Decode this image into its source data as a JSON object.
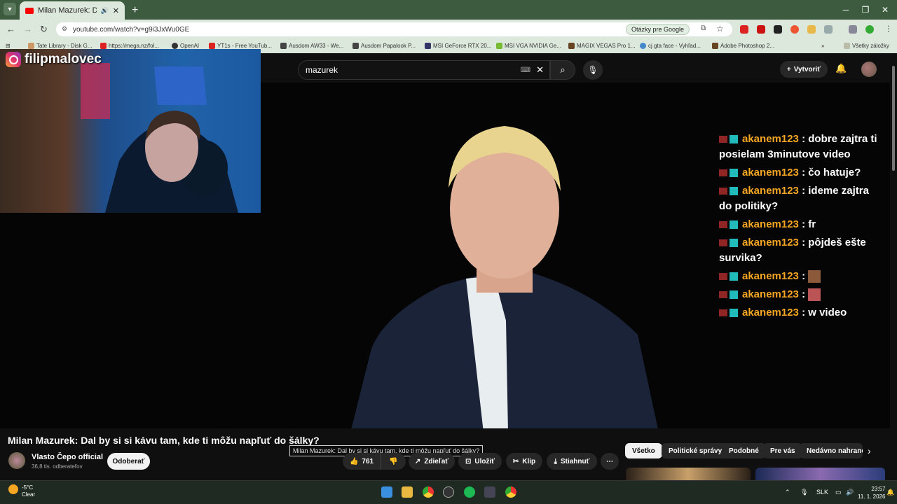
{
  "browser": {
    "tab_title": "Milan Mazurek: Dal by si s",
    "url": "youtube.com/watch?v=g9i3JxWu0GE",
    "google_chip": "Otázky pre Google",
    "bookmarks": [
      "Tate Library - Disk G...",
      "https://mega.nz/fol...",
      "OpenAI",
      "YT1s - Free YouTub...",
      "Ausdom AW33 - We...",
      "Ausdom Papalook P...",
      "MSI GeForce RTX 20...",
      "MSI VGA NVIDIA Ge...",
      "MAGIX VEGAS Pro 1...",
      "cj gta face - Vyhľad...",
      "Adobe Photoshop 2..."
    ],
    "all_bookmarks": "Všetky záložky"
  },
  "youtube": {
    "search_value": "mazurek",
    "create_label": "Vytvoriť",
    "video_title": "Milan Mazurek: Dal by si si kávu tam, kde ti môžu napľuť do šálky?",
    "tooltip": "Milan Mazurek: Dal by si si kávu tam, kde ti môžu napľuť do šálky?",
    "channel_name": "Vlasto Čepo official",
    "subscribers": "36,8 tis. odberateľov",
    "subscribe_label": "Odoberať",
    "likes": "761",
    "share_label": "Zdieľať",
    "save_label": "Uložiť",
    "clip_label": "Klip",
    "download_label": "Stiahnuť",
    "chips": [
      "Všetko",
      "Politické správy",
      "Podobné",
      "Pre vás",
      "Nedávno nahrané"
    ]
  },
  "overlay": {
    "instagram_name": "filipmalovec",
    "chat": [
      {
        "user": "akanem123",
        "text": "dobre zajtra ti posielam 3minutove video"
      },
      {
        "user": "akanem123",
        "text": "čo hatuje?"
      },
      {
        "user": "akanem123",
        "text": "ideme zajtra do politiky?"
      },
      {
        "user": "akanem123",
        "text": "fr"
      },
      {
        "user": "akanem123",
        "text": "pôjdeš ešte survika?"
      },
      {
        "user": "akanem123",
        "text": ""
      },
      {
        "user": "akanem123",
        "text": ""
      },
      {
        "user": "akanem123",
        "text": "w video"
      }
    ]
  },
  "taskbar": {
    "temperature": "-5°C",
    "weather": "Clear",
    "language": "SLK",
    "time": "23:57",
    "date": "11. 1. 2026"
  },
  "colors": {
    "chat_user": "#f5a623",
    "tab_bar": "#3d5c3f",
    "toolbar": "#dde8dd"
  }
}
